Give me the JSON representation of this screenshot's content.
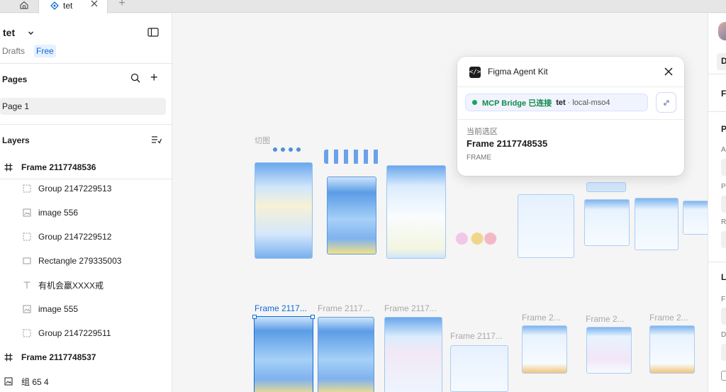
{
  "tabs": {
    "home_icon": "home-icon",
    "active_tab": {
      "title": "tet",
      "icon": "figma-component-icon"
    },
    "add_icon": "plus-icon"
  },
  "sidebar": {
    "file_name": "tet",
    "drafts_label": "Drafts",
    "plan_badge": "Free",
    "pages_heading": "Pages",
    "pages": [
      "Page 1"
    ],
    "layers_heading": "Layers",
    "layers": [
      {
        "name": "Frame 2117748536",
        "kind": "frame",
        "icon": "frame-icon"
      },
      {
        "name": "Group 2147229513",
        "kind": "group",
        "icon": "group-icon"
      },
      {
        "name": "image 556",
        "kind": "image",
        "icon": "image-icon"
      },
      {
        "name": "Group 2147229512",
        "kind": "group",
        "icon": "group-icon"
      },
      {
        "name": "Rectangle 279335003",
        "kind": "rectangle",
        "icon": "rectangle-icon"
      },
      {
        "name": "有机会羸XXXX戒",
        "kind": "text",
        "icon": "text-icon"
      },
      {
        "name": "image 555",
        "kind": "image",
        "icon": "image-icon"
      },
      {
        "name": "Group 2147229511",
        "kind": "group",
        "icon": "group-icon"
      },
      {
        "name": "Frame 2117748537",
        "kind": "frame",
        "icon": "frame-icon"
      },
      {
        "name": "组 65 4",
        "kind": "image",
        "icon": "image-icon"
      }
    ]
  },
  "canvas": {
    "section_label": "切图",
    "frame_labels_row1": [
      "Frame 2117...",
      "Frame 2117...",
      "Frame 2117..."
    ],
    "frame_labels_row2": [
      "Frame 2117...",
      "Frame 2...",
      "Frame 2...",
      "Frame 2..."
    ]
  },
  "plugin": {
    "title": "Figma Agent Kit",
    "bridge_label": "MCP Bridge 已连接",
    "project": "tet",
    "separator": "·",
    "environment": "local-mso4",
    "selection_heading": "当前选区",
    "selection_name": "Frame 2117748535",
    "selection_type": "FRAME"
  },
  "right_panel": {
    "letters": [
      "D",
      "F",
      "P",
      "A",
      "P",
      "R",
      "L",
      "F",
      "D"
    ]
  },
  "colors": {
    "accent": "#0d6bd8",
    "connected": "#1aa35c",
    "artwork_blue": "#a9cdf5"
  }
}
